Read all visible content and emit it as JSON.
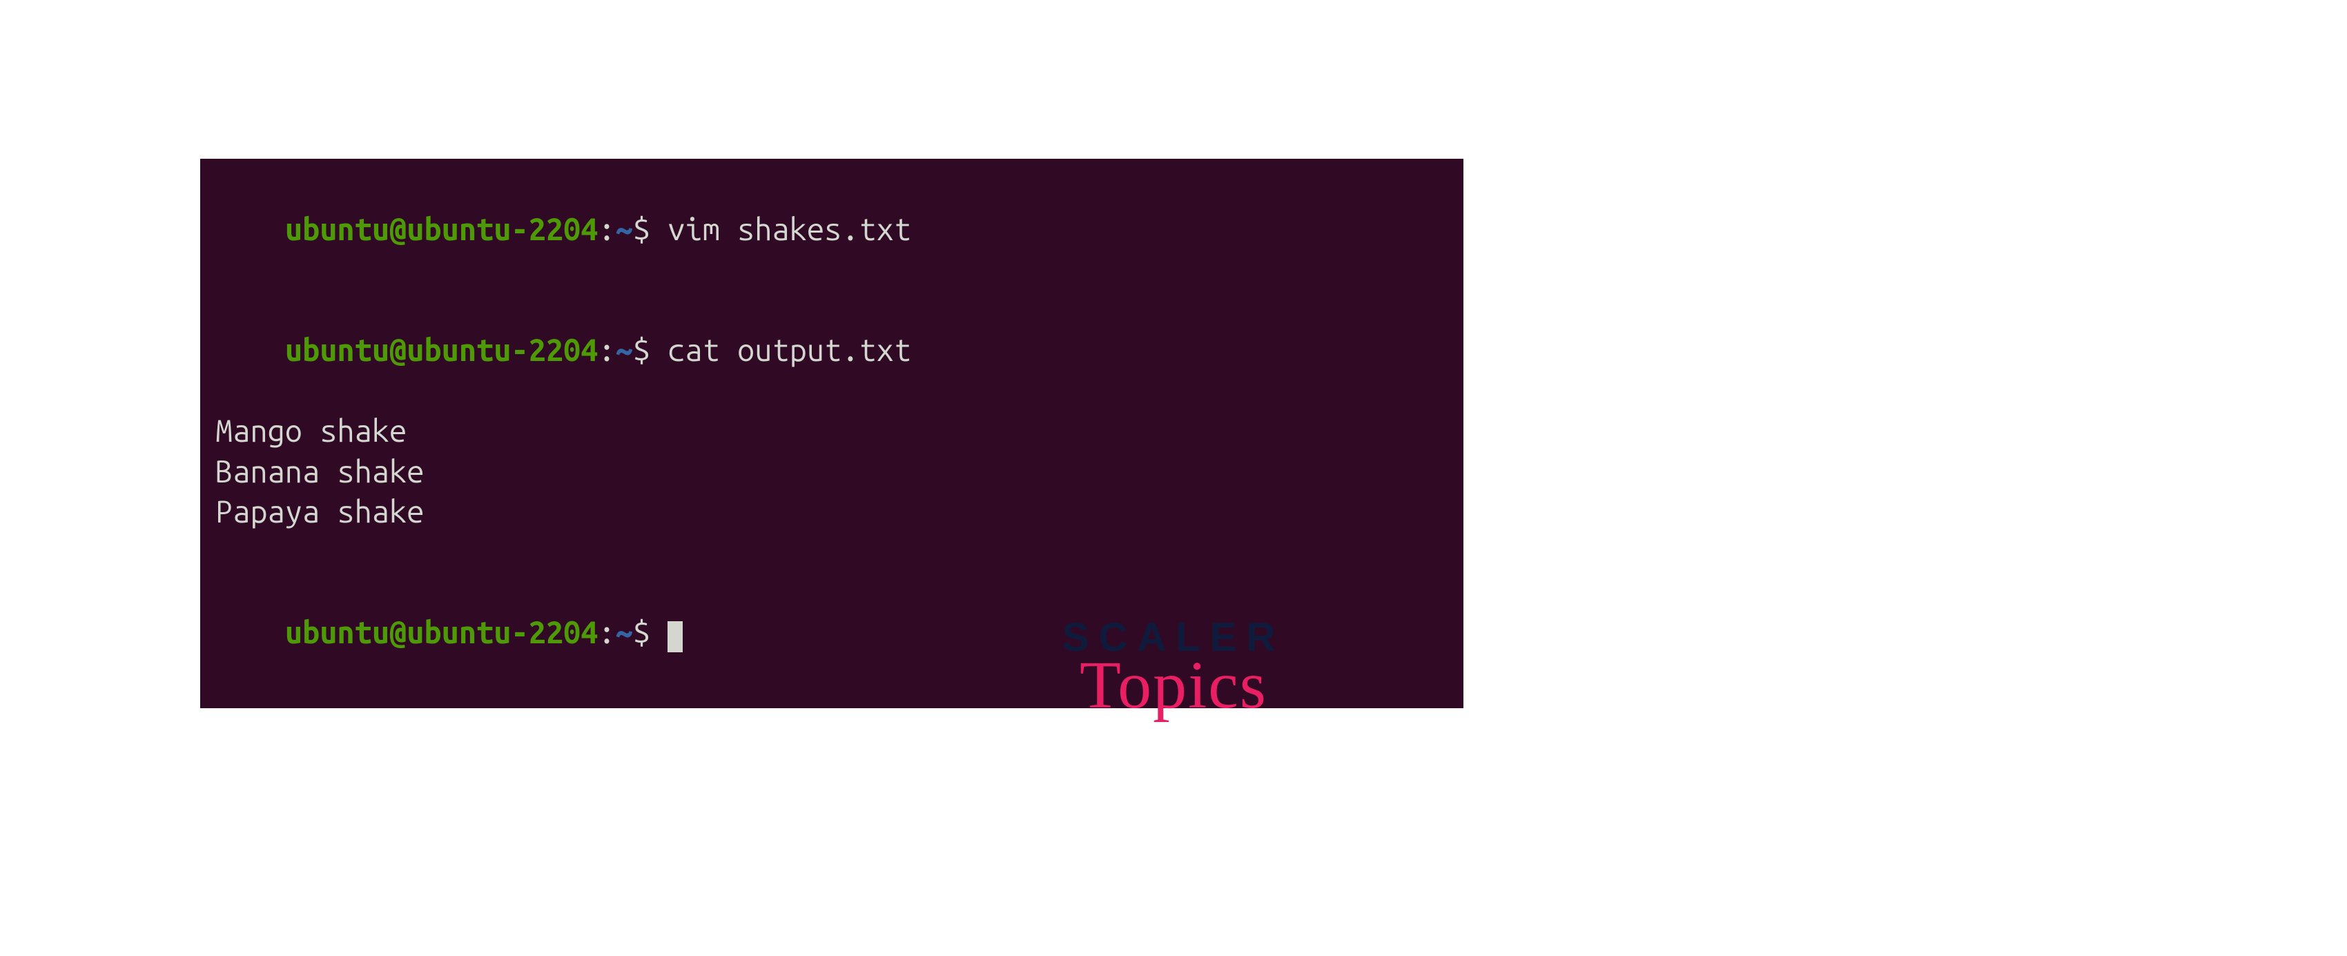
{
  "terminal": {
    "prompt": {
      "user_host": "ubuntu@ubuntu-2204",
      "colon": ":",
      "path": "~",
      "dollar": "$ "
    },
    "lines": [
      {
        "cmd": "vim shakes.txt"
      },
      {
        "cmd": "cat output.txt"
      }
    ],
    "output": [
      "Mango shake",
      "Banana shake",
      "Papaya shake"
    ]
  },
  "logo": {
    "line1": "SCALER",
    "line2": "Topics"
  }
}
